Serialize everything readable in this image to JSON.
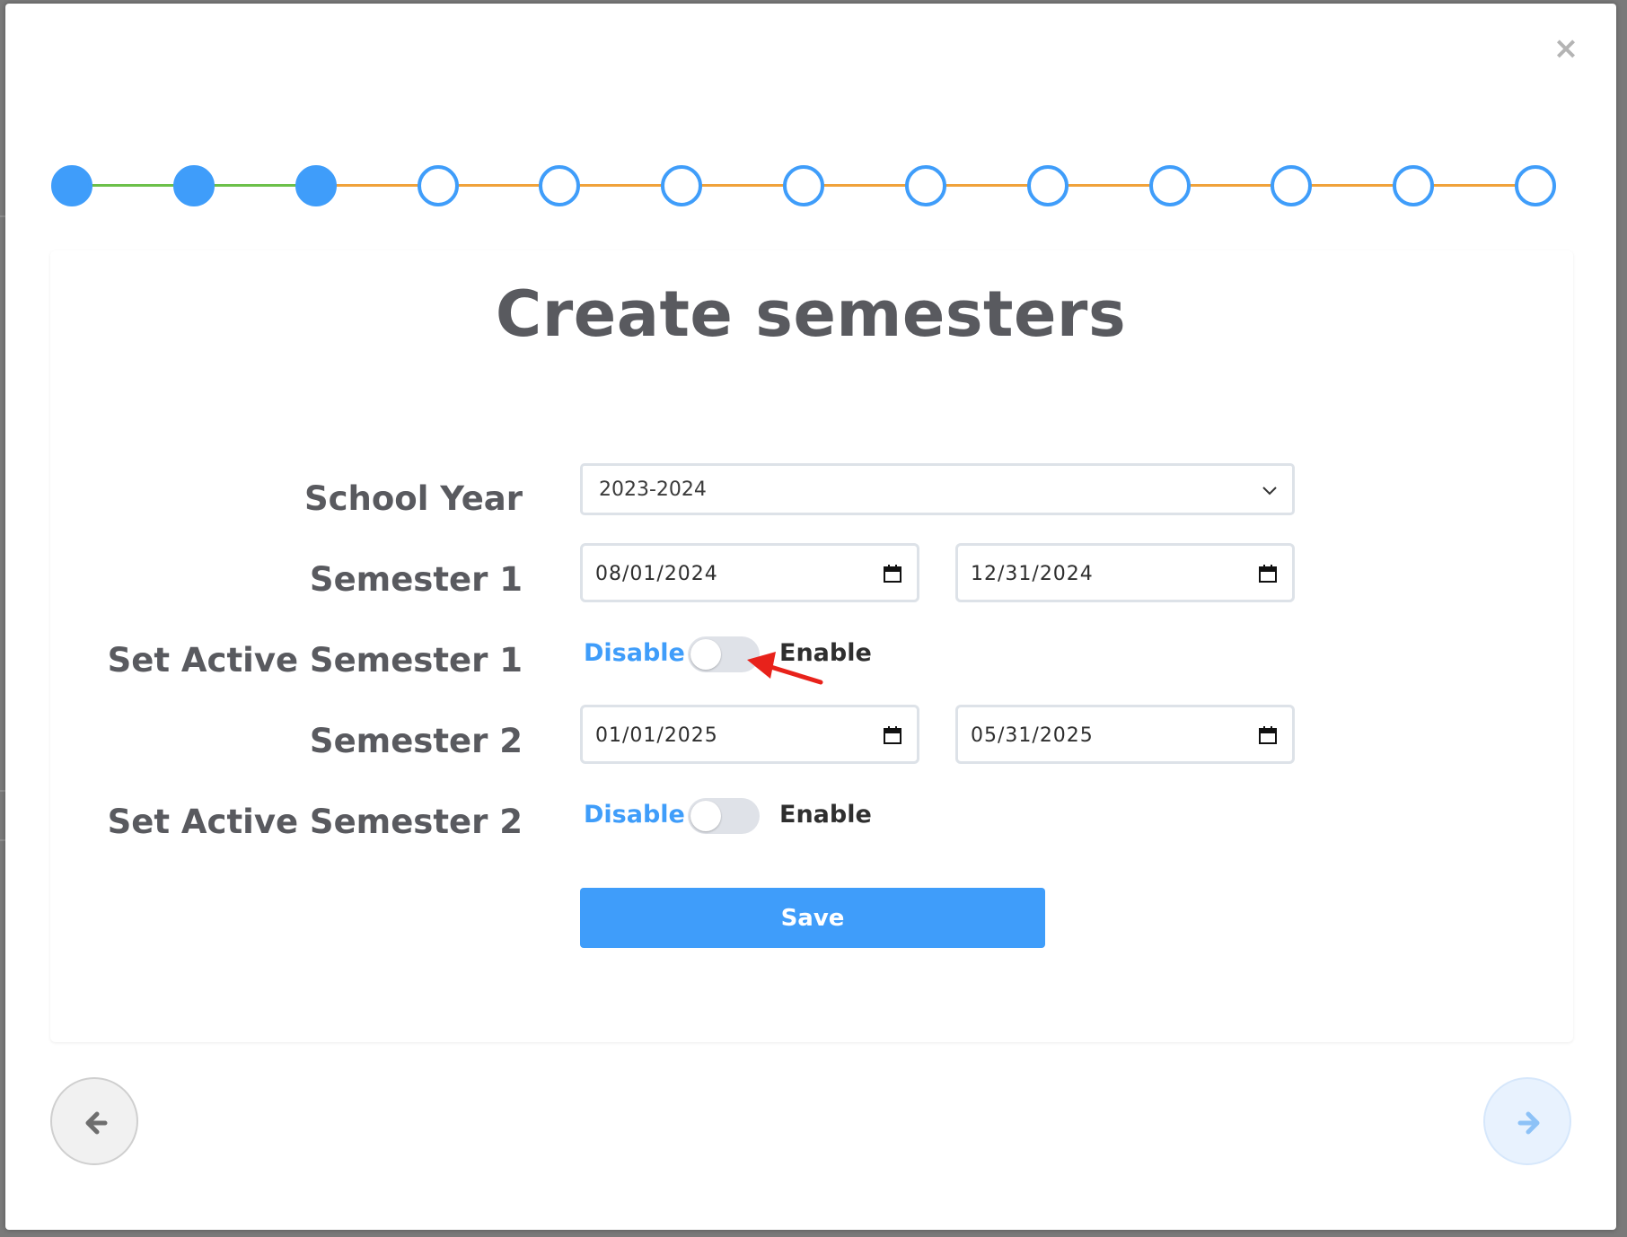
{
  "dialog": {
    "title": "Create semesters",
    "close_label": "×"
  },
  "stepper": {
    "total_steps": 13,
    "completed_steps": 3,
    "colors": {
      "dot": "#3f9dfa",
      "line_done": "#6cc04a",
      "line_pending": "#f0a23a"
    }
  },
  "form": {
    "school_year": {
      "label": "School Year",
      "value": "2023-2024"
    },
    "semester1": {
      "label": "Semester 1",
      "start": "08/01/2024",
      "end": "12/31/2024"
    },
    "active1": {
      "label": "Set Active Semester 1",
      "off_text": "Disable",
      "on_text": "Enable",
      "enabled": false
    },
    "semester2": {
      "label": "Semester 2",
      "start": "01/01/2025",
      "end": "05/31/2025"
    },
    "active2": {
      "label": "Set Active Semester 2",
      "off_text": "Disable",
      "on_text": "Enable",
      "enabled": false
    },
    "save_label": "Save"
  },
  "navigation": {
    "prev_icon": "arrow-left-icon",
    "next_icon": "arrow-right-icon"
  },
  "annotation": {
    "color": "#e8221b",
    "icon": "red-arrow-annotation"
  }
}
